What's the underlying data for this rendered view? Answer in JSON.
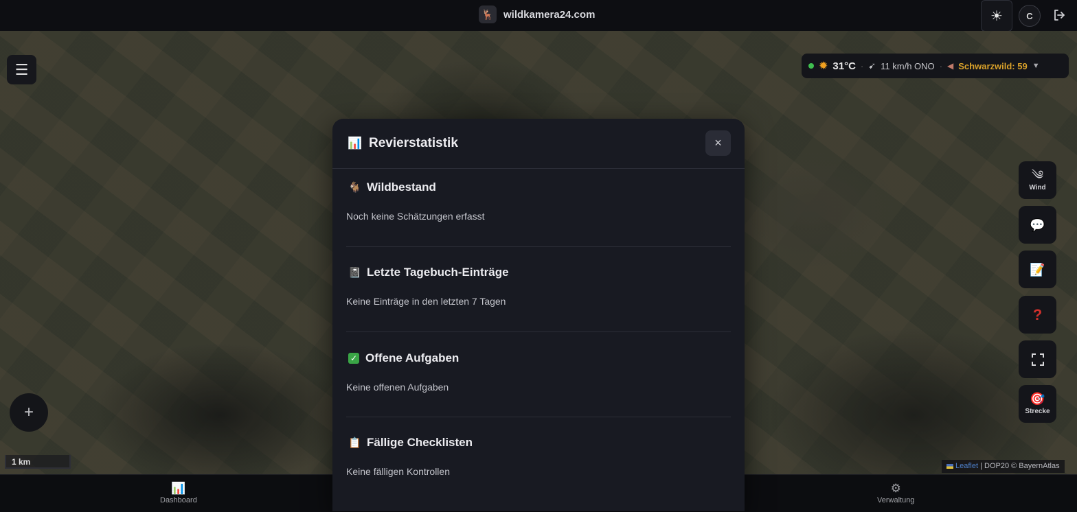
{
  "header": {
    "site_name": "wildkamera24.com",
    "logo_icon": "deer-logo-icon",
    "theme_toggle_icon": "sun-icon",
    "avatar_initial": "C",
    "logout_icon": "logout-icon"
  },
  "weather_bar": {
    "status_color": "#3fbf4f",
    "temperature": "31°C",
    "wind": "11 km/h ONO",
    "game_label": "Schwarzwild: 59",
    "game_color": "#d9a12a"
  },
  "map": {
    "scale_label": "1 km",
    "attribution_link": "Leaflet",
    "attribution_text": "| DOP20 © BayernAtlas"
  },
  "side_buttons": [
    {
      "name": "wind",
      "icon": "wind-icon",
      "label": "Wind"
    },
    {
      "name": "chat",
      "icon": "speech-bubble-icon",
      "label": ""
    },
    {
      "name": "notes",
      "icon": "memo-icon",
      "label": ""
    },
    {
      "name": "help",
      "icon": "question-icon",
      "label": ""
    },
    {
      "name": "fullscreen",
      "icon": "fullscreen-icon",
      "label": ""
    },
    {
      "name": "strecke",
      "icon": "target-icon",
      "label": "Strecke"
    }
  ],
  "bottom_nav": {
    "dashboard": "Dashboard",
    "verwaltung": "Verwaltung"
  },
  "modal": {
    "title": "Revierstatistik",
    "close_label": "×",
    "sections": [
      {
        "title": "Wildbestand",
        "icon": "deer-icon",
        "text": "Noch keine Schätzungen erfasst"
      },
      {
        "title": "Letzte Tagebuch-Einträge",
        "icon": "notebook-icon",
        "text": "Keine Einträge in den letzten 7 Tagen"
      },
      {
        "title": "Offene Aufgaben",
        "icon": "checkmark-icon",
        "text": "Keine offenen Aufgaben"
      },
      {
        "title": "Fällige Checklisten",
        "icon": "clipboard-icon",
        "text": "Keine fälligen Kontrollen"
      }
    ]
  }
}
